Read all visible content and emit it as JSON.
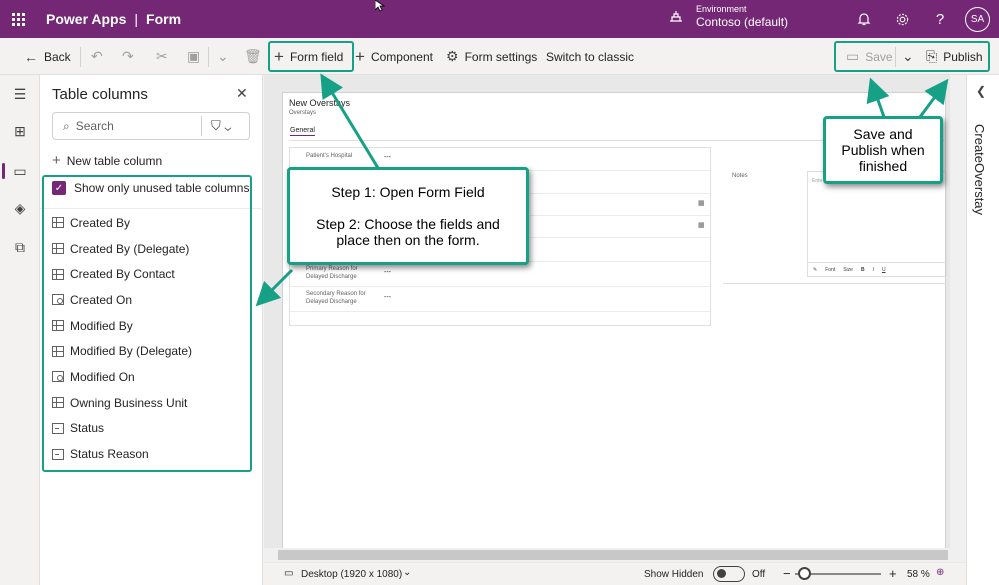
{
  "topbar": {
    "app_name": "Power Apps",
    "separator": "|",
    "page_name": "Form",
    "environment_label": "Environment",
    "environment_value": "Contoso (default)",
    "avatar_initials": "SA"
  },
  "commandbar": {
    "back": "Back",
    "form_field": "Form field",
    "component": "Component",
    "form_settings": "Form settings",
    "switch_classic": "Switch to classic",
    "save": "Save",
    "publish": "Publish"
  },
  "panel": {
    "title": "Table columns",
    "search_placeholder": "Search",
    "new_column": "New table column",
    "show_unused": "Show only unused table columns",
    "columns": [
      {
        "label": "Created By",
        "icon": "grid"
      },
      {
        "label": "Created By (Delegate)",
        "icon": "grid"
      },
      {
        "label": "Created By Contact",
        "icon": "grid"
      },
      {
        "label": "Created On",
        "icon": "clock"
      },
      {
        "label": "Modified By",
        "icon": "grid"
      },
      {
        "label": "Modified By (Delegate)",
        "icon": "grid"
      },
      {
        "label": "Modified On",
        "icon": "clock"
      },
      {
        "label": "Owning Business Unit",
        "icon": "grid"
      },
      {
        "label": "Status",
        "icon": "box"
      },
      {
        "label": "Status Reason",
        "icon": "box"
      }
    ]
  },
  "form": {
    "title": "New Overstays",
    "subtitle": "Overstays",
    "tab": "General",
    "fields": [
      {
        "label": "Patient's Hospital",
        "value": "---"
      },
      {
        "label": "Primary Reason for Delayed Discharge",
        "value": "---"
      },
      {
        "label": "Secondary Reason for Delayed Discharge",
        "value": "---"
      }
    ],
    "notes_label": "Notes",
    "notes_placeholder": "Ente",
    "toolbar_font": "Font",
    "toolbar_size": "Size",
    "toolbar_b": "B",
    "toolbar_i": "I",
    "toolbar_u": "U"
  },
  "statusbar": {
    "device": "Desktop (1920 x 1080)",
    "show_hidden": "Show Hidden",
    "toggle_state": "Off",
    "zoom_minus": "−",
    "zoom_plus": "+",
    "zoom_value": "58 %"
  },
  "rightpane": {
    "title": "CreateOverstay"
  },
  "annotations": {
    "step_text_1": "Step 1: Open Form Field",
    "step_text_2": "Step 2: Choose the fields and place then on the form.",
    "save_text": "Save and Publish when finished"
  },
  "colors": {
    "brand": "#742774",
    "annotation": "#16a085"
  }
}
